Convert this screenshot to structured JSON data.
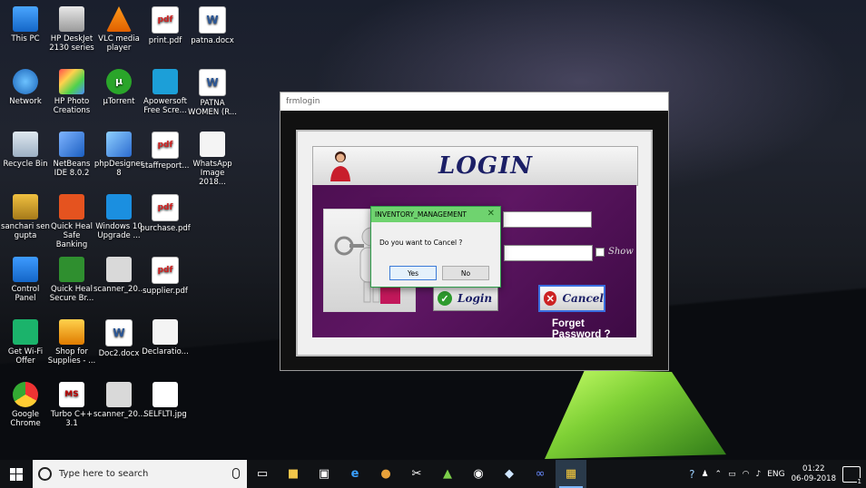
{
  "desktop": {
    "icons": [
      {
        "label": "This PC",
        "icon": "computer-icon",
        "glyph": ""
      },
      {
        "label": "HP DeskJet 2130 series",
        "icon": "printer-icon",
        "glyph": ""
      },
      {
        "label": "VLC media player",
        "icon": "vlc-icon",
        "glyph": ""
      },
      {
        "label": "print.pdf",
        "icon": "pdf-file-icon",
        "glyph": "pdf"
      },
      {
        "label": "patna.docx",
        "icon": "word-file-icon",
        "glyph": "W"
      },
      {
        "label": "Network",
        "icon": "network-icon",
        "glyph": ""
      },
      {
        "label": "HP Photo Creations",
        "icon": "hp-photo-icon",
        "glyph": ""
      },
      {
        "label": "µTorrent",
        "icon": "utorrent-icon",
        "glyph": "µ"
      },
      {
        "label": "Apowersoft Free Scre...",
        "icon": "apowersoft-icon",
        "glyph": ""
      },
      {
        "label": "PATNA WOMEN (R...",
        "icon": "word-file-icon",
        "glyph": "W"
      },
      {
        "label": "Recycle Bin",
        "icon": "recycle-bin-icon",
        "glyph": ""
      },
      {
        "label": "NetBeans IDE 8.0.2",
        "icon": "netbeans-icon",
        "glyph": ""
      },
      {
        "label": "phpDesigner 8",
        "icon": "phpdesigner-icon",
        "glyph": ""
      },
      {
        "label": "staffreport...",
        "icon": "pdf-file-icon",
        "glyph": "pdf"
      },
      {
        "label": "WhatsApp Image 2018...",
        "icon": "image-file-icon",
        "glyph": ""
      },
      {
        "label": "sanchari sen gupta",
        "icon": "user-folder-icon",
        "glyph": ""
      },
      {
        "label": "Quick Heal Safe Banking",
        "icon": "quickheal-icon",
        "glyph": ""
      },
      {
        "label": "Windows 10 Upgrade ...",
        "icon": "windows-upgrade-icon",
        "glyph": ""
      },
      {
        "label": "purchase.pdf",
        "icon": "pdf-file-icon",
        "glyph": "pdf"
      },
      {
        "label": "Control Panel",
        "icon": "control-panel-icon",
        "glyph": ""
      },
      {
        "label": "Quick Heal Secure Br...",
        "icon": "quickheal-browser-icon",
        "glyph": ""
      },
      {
        "label": "scanner_20...",
        "icon": "scan-file-icon",
        "glyph": ""
      },
      {
        "label": "supplier.pdf",
        "icon": "pdf-file-icon",
        "glyph": "pdf"
      },
      {
        "label": "Get Wi-Fi Offer",
        "icon": "wifi-offer-icon",
        "glyph": ""
      },
      {
        "label": "Shop for Supplies - ...",
        "icon": "shop-supplies-icon",
        "glyph": ""
      },
      {
        "label": "Doc2.docx",
        "icon": "word-file-icon",
        "glyph": "W"
      },
      {
        "label": "Declaratio...",
        "icon": "document-file-icon",
        "glyph": ""
      },
      {
        "label": "Google Chrome",
        "icon": "chrome-icon",
        "glyph": ""
      },
      {
        "label": "Turbo C++ 3.1",
        "icon": "turbo-cpp-icon",
        "glyph": "MS"
      },
      {
        "label": "scanner_20...",
        "icon": "scan-file-icon",
        "glyph": ""
      },
      {
        "label": "SELFLTI.jpg",
        "icon": "jpg-file-icon",
        "glyph": ""
      }
    ]
  },
  "login_window": {
    "title": "frmlogin",
    "heading": "LOGIN",
    "username_value": "",
    "password_value": "",
    "show_label": "Show",
    "login_button": "Login",
    "cancel_button": "Cancel",
    "forget_password": "Forget Password ?"
  },
  "message_box": {
    "title": "INVENTORY_MANAGEMENT",
    "message": "Do you want to Cancel ?",
    "yes_button": "Yes",
    "no_button": "No",
    "close_glyph": "✕"
  },
  "taskbar": {
    "search_placeholder": "Type here to search",
    "language": "ENG",
    "time": "01:22",
    "date": "06-09-2018",
    "notification_count": "1"
  },
  "colors": {
    "purple_panel": "#5e1663",
    "title_navy": "#1b1f66",
    "msgbox_title": "#6fd36f"
  }
}
